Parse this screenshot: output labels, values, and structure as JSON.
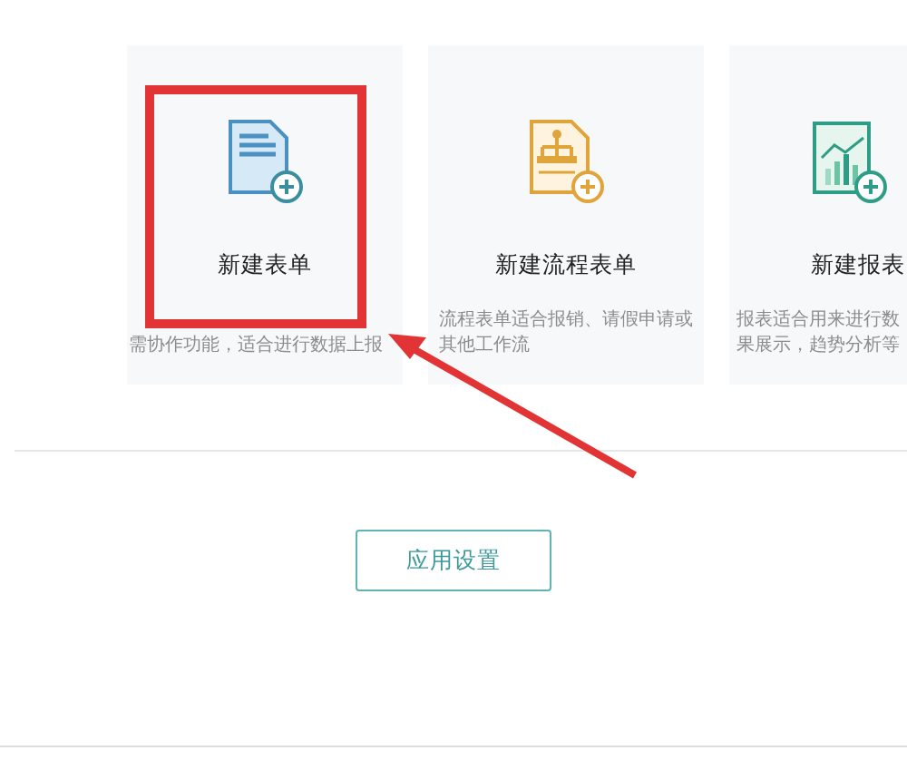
{
  "cards": [
    {
      "kind": "form",
      "title": "新建表单",
      "description": [
        "需协作功能，适合进行数据上报"
      ]
    },
    {
      "kind": "flow",
      "title": "新建流程表单",
      "description": [
        "流程表单适合报销、请假申请或",
        "其他工作流"
      ]
    },
    {
      "kind": "report",
      "title": "新建报表",
      "description": [
        "报表适合用来进行数",
        "果展示，趋势分析等"
      ]
    }
  ],
  "settings_button": "应用设置"
}
